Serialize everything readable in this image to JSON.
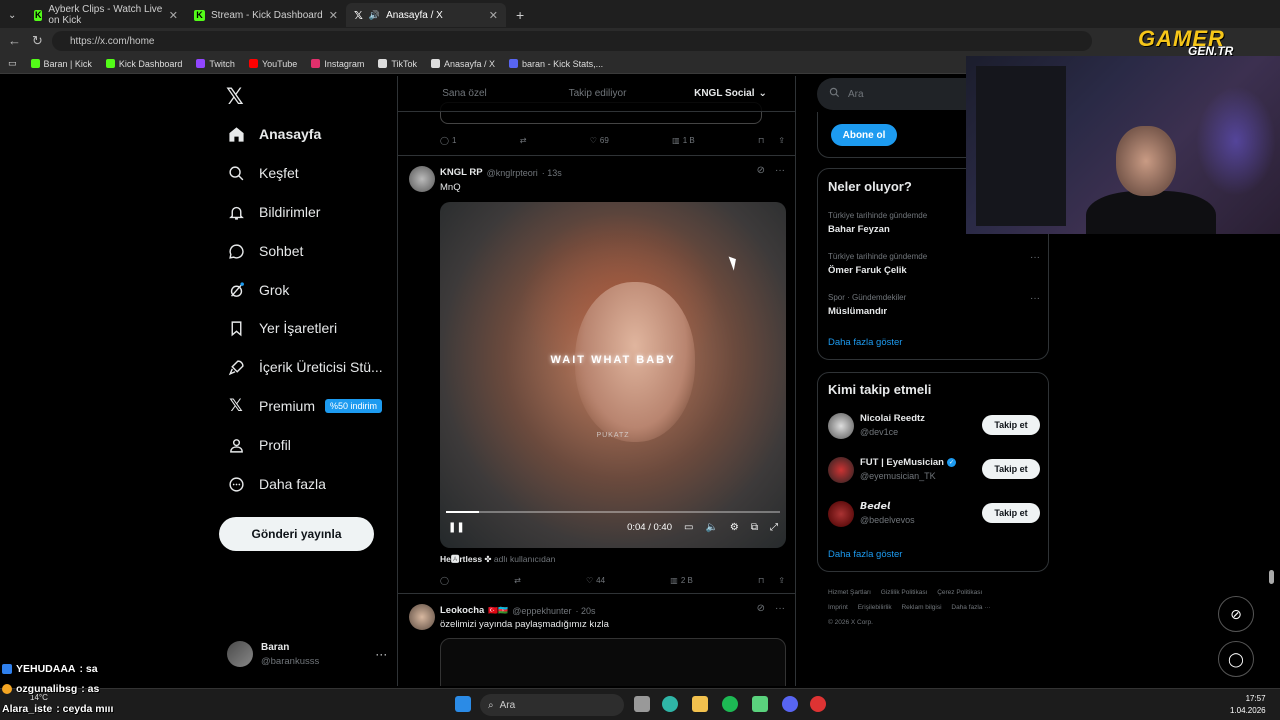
{
  "browser": {
    "tabs": [
      {
        "title": "Ayberk Clips - Watch Live on Kick"
      },
      {
        "title": "Stream - Kick Dashboard"
      },
      {
        "title": "Anasayfa / X"
      }
    ],
    "url": "https://x.com/home",
    "bookmarks": [
      {
        "label": "Baran | Kick",
        "color": "#53fc18"
      },
      {
        "label": "Kick Dashboard",
        "color": "#53fc18"
      },
      {
        "label": "Twitch",
        "color": "#9146ff"
      },
      {
        "label": "YouTube",
        "color": "#ff0000"
      },
      {
        "label": "Instagram",
        "color": "#e1306c"
      },
      {
        "label": "TikTok",
        "color": "#ffffff"
      },
      {
        "label": "Anasayfa / X",
        "color": "#ffffff"
      },
      {
        "label": "baran - Kick Stats,...",
        "color": "#5865f2"
      }
    ]
  },
  "nav": {
    "items": [
      {
        "label": "Anasayfa",
        "icon": "home-icon"
      },
      {
        "label": "Keşfet",
        "icon": "search-icon"
      },
      {
        "label": "Bildirimler",
        "icon": "bell-icon"
      },
      {
        "label": "Sohbet",
        "icon": "chat-icon"
      },
      {
        "label": "Grok",
        "icon": "grok-icon"
      },
      {
        "label": "Yer İşaretleri",
        "icon": "bookmark-icon"
      },
      {
        "label": "İçerik Üreticisi Stü...",
        "icon": "rocket-icon"
      },
      {
        "label": "Premium",
        "icon": "x-icon"
      },
      {
        "label": "Profil",
        "icon": "person-icon"
      },
      {
        "label": "Daha fazla",
        "icon": "more-circle-icon"
      }
    ],
    "premium_badge": "%50 indirim",
    "post_button": "Gönderi yayınla",
    "account": {
      "name": "Baran",
      "handle": "@barankusss"
    }
  },
  "feed": {
    "tabs": [
      "Sana özel",
      "Takip ediliyor",
      "KNGL Social"
    ],
    "top_actions": {
      "replies": "1",
      "likes": "69",
      "views": "1 B"
    },
    "post1": {
      "name": "KNGL RP",
      "handle": "@knglrpteori",
      "time": "· 13s",
      "text": "MnQ",
      "video_text": "WAIT WHAT BABY",
      "video_watermark": "PUKATZ",
      "time_display": "0:04 / 0:40",
      "progress": 0.1,
      "caption_user": "He🅰rtless ✤",
      "caption_rest": "adlı kullanıcıdan",
      "actions": {
        "replies": "",
        "likes": "44",
        "views": "2 B"
      }
    },
    "post2": {
      "name": "Leokocha",
      "handle": "@eppekhunter",
      "time": "· 20s",
      "text": "özelimizi yayında paylaşmadığımız kızla"
    }
  },
  "sidebar": {
    "search_placeholder": "Ara",
    "subscribe": "Abone ol",
    "trends_title": "Neler oluyor?",
    "trends": [
      {
        "context": "Türkiye tarihinde gündemde",
        "name": "Bahar Feyzan"
      },
      {
        "context": "Türkiye tarihinde gündemde",
        "name": "Ömer Faruk Çelik"
      },
      {
        "context": "Spor · Gündemdekiler",
        "name": "Müslümandır"
      }
    ],
    "show_more": "Daha fazla göster",
    "who_title": "Kimi takip etmeli",
    "who": [
      {
        "name": "Nicolai Reedtz",
        "handle": "@dev1ce",
        "verified": false
      },
      {
        "name": "FUT | EyeMusician",
        "handle": "@eyemusician_TK",
        "verified": true
      },
      {
        "name": "𝘽𝙚𝙙𝙚𝙡",
        "handle": "@bedelvevos",
        "verified": false
      }
    ],
    "follow_label": "Takip et",
    "footer": [
      "Hizmet Şartları",
      "Gizlilik Politikası",
      "Çerez Politikası",
      "Imprint",
      "Erişilebilirlik",
      "Reklam bilgisi",
      "Daha fazla ···",
      "© 2026 X Corp."
    ]
  },
  "overlay": {
    "logo_top": "GAMER",
    "logo_bottom": "GEN.TR",
    "chat": [
      {
        "user": "YEHUDAAA",
        "msg": ": sa"
      },
      {
        "user": "ozgunalibsg",
        "msg": ": as"
      },
      {
        "user": "Alara_iste",
        "msg": ": ceyda mııı"
      }
    ]
  },
  "taskbar": {
    "search": "Ara",
    "time": "17:57",
    "date": "1.04.2026",
    "weather": "14°C"
  }
}
